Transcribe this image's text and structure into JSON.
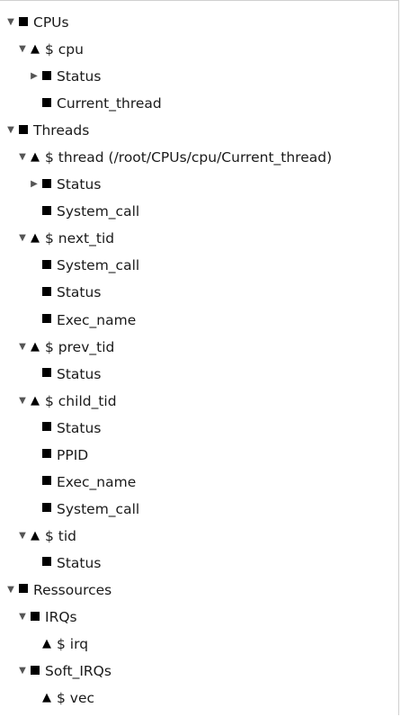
{
  "tree": [
    {
      "label": "CPUs",
      "depth": 0,
      "expander": "expanded",
      "icon": "square"
    },
    {
      "label": "$ cpu",
      "depth": 1,
      "expander": "expanded",
      "icon": "triangle"
    },
    {
      "label": "Status",
      "depth": 2,
      "expander": "collapsed",
      "icon": "square"
    },
    {
      "label": "Current_thread",
      "depth": 2,
      "expander": "none",
      "icon": "square"
    },
    {
      "label": "Threads",
      "depth": 0,
      "expander": "expanded",
      "icon": "square"
    },
    {
      "label": "$ thread (/root/CPUs/cpu/Current_thread)",
      "depth": 1,
      "expander": "expanded",
      "icon": "triangle"
    },
    {
      "label": "Status",
      "depth": 2,
      "expander": "collapsed",
      "icon": "square"
    },
    {
      "label": "System_call",
      "depth": 2,
      "expander": "none",
      "icon": "square"
    },
    {
      "label": "$ next_tid",
      "depth": 1,
      "expander": "expanded",
      "icon": "triangle"
    },
    {
      "label": "System_call",
      "depth": 2,
      "expander": "none",
      "icon": "square"
    },
    {
      "label": "Status",
      "depth": 2,
      "expander": "none",
      "icon": "square"
    },
    {
      "label": "Exec_name",
      "depth": 2,
      "expander": "none",
      "icon": "square"
    },
    {
      "label": "$ prev_tid",
      "depth": 1,
      "expander": "expanded",
      "icon": "triangle"
    },
    {
      "label": "Status",
      "depth": 2,
      "expander": "none",
      "icon": "square"
    },
    {
      "label": "$ child_tid",
      "depth": 1,
      "expander": "expanded",
      "icon": "triangle"
    },
    {
      "label": "Status",
      "depth": 2,
      "expander": "none",
      "icon": "square"
    },
    {
      "label": "PPID",
      "depth": 2,
      "expander": "none",
      "icon": "square"
    },
    {
      "label": "Exec_name",
      "depth": 2,
      "expander": "none",
      "icon": "square"
    },
    {
      "label": "System_call",
      "depth": 2,
      "expander": "none",
      "icon": "square"
    },
    {
      "label": "$ tid",
      "depth": 1,
      "expander": "expanded",
      "icon": "triangle"
    },
    {
      "label": "Status",
      "depth": 2,
      "expander": "none",
      "icon": "square"
    },
    {
      "label": "Ressources",
      "depth": 0,
      "expander": "expanded",
      "icon": "square"
    },
    {
      "label": "IRQs",
      "depth": 1,
      "expander": "expanded",
      "icon": "square"
    },
    {
      "label": "$ irq",
      "depth": 2,
      "expander": "none",
      "icon": "triangle"
    },
    {
      "label": "Soft_IRQs",
      "depth": 1,
      "expander": "expanded",
      "icon": "square"
    },
    {
      "label": "$ vec",
      "depth": 2,
      "expander": "none",
      "icon": "triangle"
    }
  ]
}
